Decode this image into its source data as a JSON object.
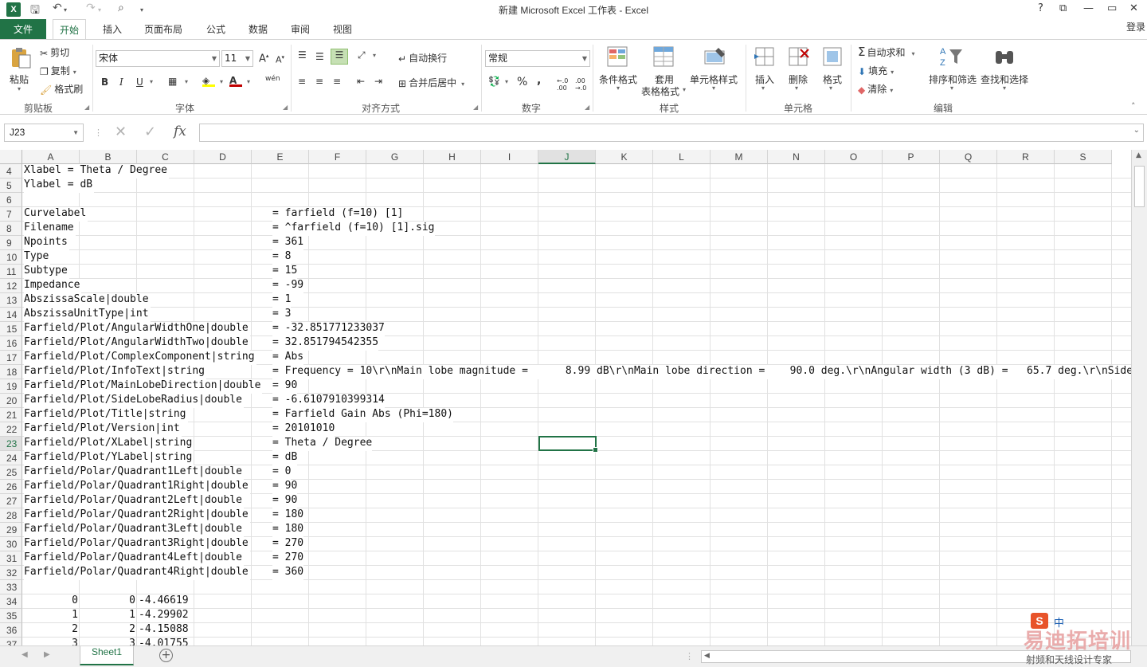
{
  "titlebar": {
    "title": "新建 Microsoft Excel 工作表 - Excel",
    "help": "?",
    "restore_label": "⧉",
    "min_label": "▭",
    "close_label": "✕"
  },
  "tabs": {
    "file": "文件",
    "items": [
      "开始",
      "插入",
      "页面布局",
      "公式",
      "数据",
      "审阅",
      "视图"
    ],
    "login": "登录"
  },
  "ribbon": {
    "clipboard": {
      "paste": "粘贴",
      "cut": "剪切",
      "copy": "复制",
      "format_painter": "格式刷",
      "label": "剪贴板"
    },
    "font": {
      "name": "宋体",
      "size": "11",
      "label": "字体",
      "bold": "B",
      "italic": "I",
      "underline": "U",
      "phonetic": "wén"
    },
    "alignment": {
      "wrap": "自动换行",
      "merge": "合并后居中",
      "label": "对齐方式"
    },
    "number": {
      "format": "常规",
      "percent": "%",
      "comma": ",",
      "label": "数字"
    },
    "styles": {
      "conditional": "条件格式",
      "table": "套用",
      "table2": "表格格式",
      "cell_styles": "单元格样式",
      "label": "样式"
    },
    "cells": {
      "insert": "插入",
      "delete": "删除",
      "format": "格式",
      "label": "单元格"
    },
    "editing": {
      "autosum": "自动求和",
      "fill": "填充",
      "clear": "清除",
      "sort": "排序和筛选",
      "find": "查找和选择",
      "label": "编辑"
    }
  },
  "formula_bar": {
    "name_box": "J23",
    "fx": "fx",
    "value": ""
  },
  "columns": [
    "A",
    "B",
    "C",
    "D",
    "E",
    "F",
    "G",
    "H",
    "I",
    "J",
    "K",
    "L",
    "M",
    "N",
    "O",
    "P",
    "Q",
    "R",
    "S"
  ],
  "rows": [
    {
      "n": "4",
      "a": "Xlabel   = Theta / Degree",
      "e": ""
    },
    {
      "n": "5",
      "a": "Ylabel   = dB",
      "e": ""
    },
    {
      "n": "6",
      "a": "",
      "e": ""
    },
    {
      "n": "7",
      "a": "Curvelabel",
      "e": "= farfield (f=10) [1]"
    },
    {
      "n": "8",
      "a": "Filename",
      "e": "= ^farfield (f=10) [1].sig"
    },
    {
      "n": "9",
      "a": "Npoints",
      "e": "= 361"
    },
    {
      "n": "10",
      "a": "Type",
      "e": "= 8"
    },
    {
      "n": "11",
      "a": "Subtype",
      "e": "= 15"
    },
    {
      "n": "12",
      "a": "Impedance",
      "e": "= -99"
    },
    {
      "n": "13",
      "a": "AbszissaScale|double",
      "e": "= 1"
    },
    {
      "n": "14",
      "a": "AbszissaUnitType|int",
      "e": "= 3"
    },
    {
      "n": "15",
      "a": "Farfield/Plot/AngularWidthOne|double",
      "e": "= -32.851771233037"
    },
    {
      "n": "16",
      "a": "Farfield/Plot/AngularWidthTwo|double",
      "e": "= 32.851794542355"
    },
    {
      "n": "17",
      "a": "Farfield/Plot/ComplexComponent|string",
      "e": "= Abs"
    },
    {
      "n": "18",
      "a": "Farfield/Plot/InfoText|string",
      "e": "= Frequency = 10\\r\\nMain lobe magnitude =      8.99 dB\\r\\nMain lobe direction =    90.0 deg.\\r\\nAngular width (3 dB) =   65.7 deg.\\r\\nSide"
    },
    {
      "n": "19",
      "a": "Farfield/Plot/MainLobeDirection|double",
      "e": "= 90"
    },
    {
      "n": "20",
      "a": "Farfield/Plot/SideLobeRadius|double",
      "e": "= -6.6107910399314"
    },
    {
      "n": "21",
      "a": "Farfield/Plot/Title|string",
      "e": "= Farfield Gain Abs (Phi=180)"
    },
    {
      "n": "22",
      "a": "Farfield/Plot/Version|int",
      "e": "= 20101010"
    },
    {
      "n": "23",
      "a": "Farfield/Plot/XLabel|string",
      "e": "= Theta / Degree"
    },
    {
      "n": "24",
      "a": "Farfield/Plot/YLabel|string",
      "e": "= dB"
    },
    {
      "n": "25",
      "a": "Farfield/Polar/Quadrant1Left|double",
      "e": "= 0"
    },
    {
      "n": "26",
      "a": "Farfield/Polar/Quadrant1Right|double",
      "e": "= 90"
    },
    {
      "n": "27",
      "a": "Farfield/Polar/Quadrant2Left|double",
      "e": "= 90"
    },
    {
      "n": "28",
      "a": "Farfield/Polar/Quadrant2Right|double",
      "e": "= 180"
    },
    {
      "n": "29",
      "a": "Farfield/Polar/Quadrant3Left|double",
      "e": "= 180"
    },
    {
      "n": "30",
      "a": "Farfield/Polar/Quadrant3Right|double",
      "e": "= 270"
    },
    {
      "n": "31",
      "a": "Farfield/Polar/Quadrant4Left|double",
      "e": "= 270"
    },
    {
      "n": "32",
      "a": "Farfield/Polar/Quadrant4Right|double",
      "e": "= 360"
    },
    {
      "n": "33",
      "a": "",
      "e": ""
    },
    {
      "n": "34",
      "a": "",
      "e": "",
      "nums": [
        "0",
        "0",
        "-4.46619"
      ]
    },
    {
      "n": "35",
      "a": "",
      "e": "",
      "nums": [
        "1",
        "1",
        "-4.29902"
      ]
    },
    {
      "n": "36",
      "a": "",
      "e": "",
      "nums": [
        "2",
        "2",
        "-4.15088"
      ]
    },
    {
      "n": "37",
      "a": "",
      "e": "",
      "nums": [
        "3",
        "3",
        "-4.01755"
      ]
    }
  ],
  "selected": {
    "column": "J",
    "row": "23"
  },
  "sheet": {
    "name": "Sheet1",
    "add": "+"
  },
  "watermark": {
    "brand": "易迪拓培训",
    "slogan": "射频和天线设计专家",
    "ime": "中",
    "logo": "S"
  },
  "colors": {
    "accent": "#217346"
  }
}
